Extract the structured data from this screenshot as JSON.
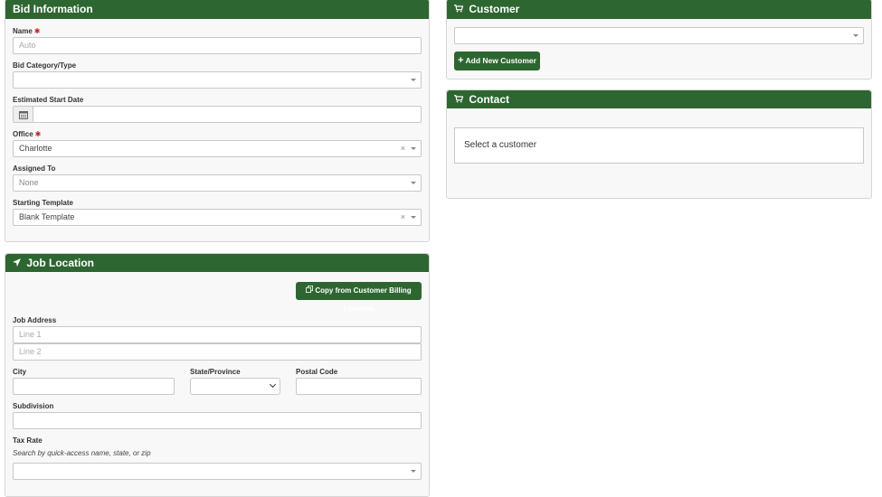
{
  "bid_info": {
    "title": "Bid Information",
    "name_label": "Name",
    "name_placeholder": "Auto",
    "category_label": "Bid Category/Type",
    "category_value": "",
    "start_date_label": "Estimated Start Date",
    "start_date_value": "",
    "office_label": "Office",
    "office_value": "Charlotte",
    "assigned_label": "Assigned To",
    "assigned_value": "None",
    "template_label": "Starting Template",
    "template_value": "Blank Template",
    "required_mark": "✱",
    "clear_glyph": "×"
  },
  "job_location": {
    "title": "Job Location",
    "copy_button": "Copy from Customer Billing Location",
    "address_label": "Job Address",
    "line1_placeholder": "Line 1",
    "line2_placeholder": "Line 2",
    "city_label": "City",
    "state_label": "State/Province",
    "postal_label": "Postal Code",
    "subdivision_label": "Subdivision",
    "tax_label": "Tax Rate",
    "tax_hint": "Search by quick-access name, state, or zip"
  },
  "customer": {
    "title": "Customer",
    "add_button": "Add New Customer",
    "add_glyph": "+"
  },
  "contact": {
    "title": "Contact",
    "placeholder": "Select a customer"
  },
  "icons": {
    "cart": "🛒",
    "arrow": "➤",
    "calendar": "▦",
    "copy": "⧉"
  },
  "colors": {
    "header_green": "#2d6630",
    "required_red": "#b22222"
  }
}
